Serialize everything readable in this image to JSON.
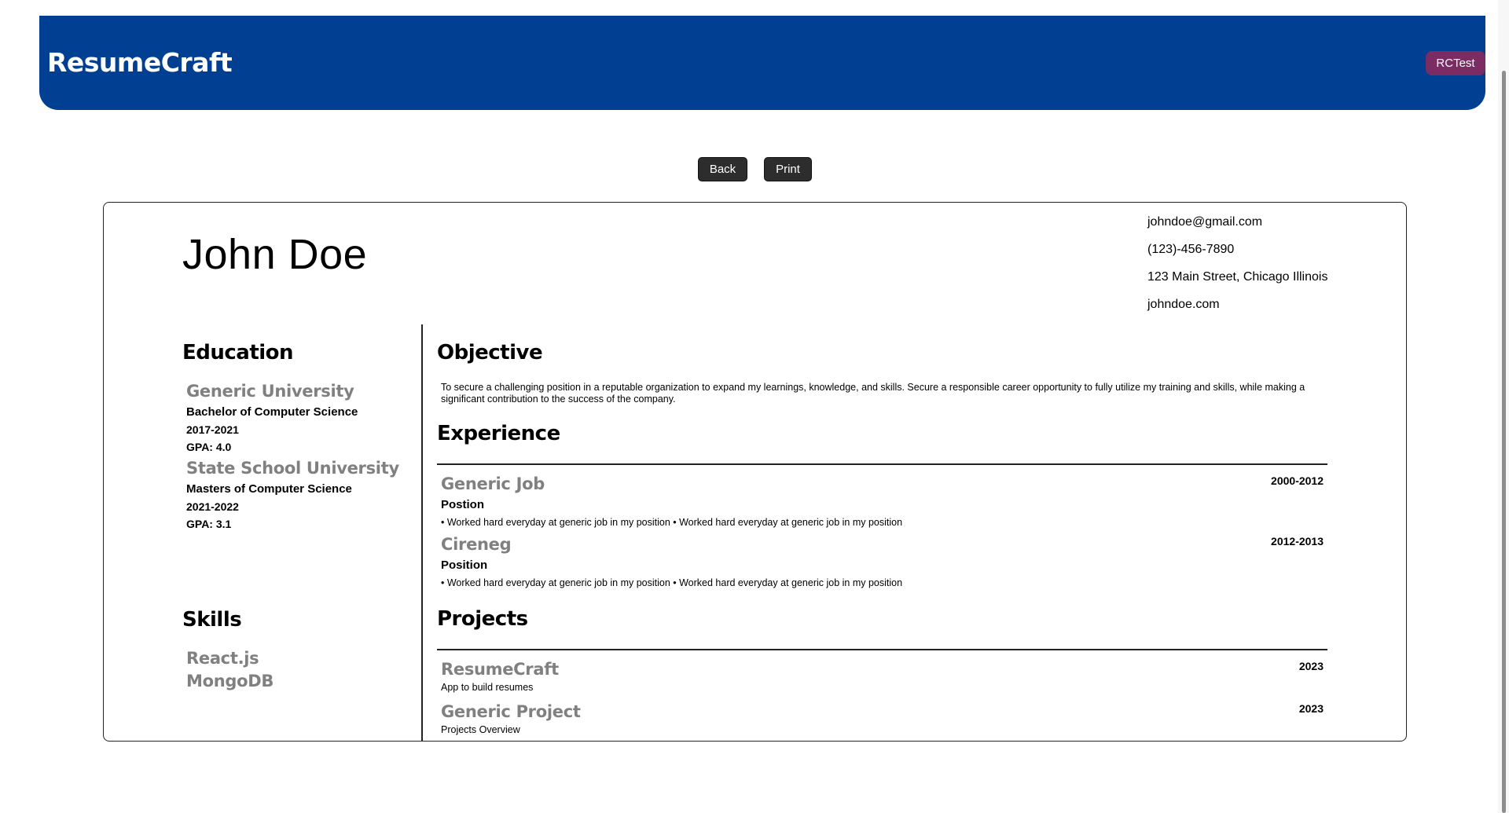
{
  "header": {
    "logo": "ResumeCraft",
    "user_label": "RCTest"
  },
  "actions": {
    "back_label": "Back",
    "print_label": "Print"
  },
  "resume": {
    "name": "John Doe",
    "contact": {
      "email": "johndoe@gmail.com",
      "phone": "(123)-456-7890",
      "address": "123 Main Street, Chicago Illinois",
      "website": "johndoe.com"
    },
    "education": {
      "title": "Education",
      "items": [
        {
          "school": "Generic University",
          "degree": "Bachelor of Computer Science",
          "years": "2017-2021",
          "gpa": "GPA: 4.0"
        },
        {
          "school": "State School University",
          "degree": "Masters of Computer Science",
          "years": "2021-2022",
          "gpa": "GPA: 3.1"
        }
      ]
    },
    "skills": {
      "title": "Skills",
      "items": [
        "React.js",
        "MongoDB"
      ]
    },
    "objective": {
      "title": "Objective",
      "text": "To secure a challenging position in a reputable organization to expand my learnings, knowledge, and skills. Secure a responsible career opportunity to fully utilize my training and skills, while making a significant contribution to the success of the company."
    },
    "experience": {
      "title": "Experience",
      "items": [
        {
          "company": "Generic Job",
          "dates": "2000-2012",
          "position": "Postion",
          "description": "• Worked hard everyday at generic job in my position • Worked hard everyday at generic job in my position"
        },
        {
          "company": "Cireneg",
          "dates": "2012-2013",
          "position": "Position",
          "description": "• Worked hard everyday at generic job in my position • Worked hard everyday at generic job in my position"
        }
      ]
    },
    "projects": {
      "title": "Projects",
      "items": [
        {
          "name": "ResumeCraft",
          "year": "2023",
          "description": "App to build resumes"
        },
        {
          "name": "Generic Project",
          "year": "2023",
          "description": "Projects Overview"
        }
      ]
    }
  }
}
